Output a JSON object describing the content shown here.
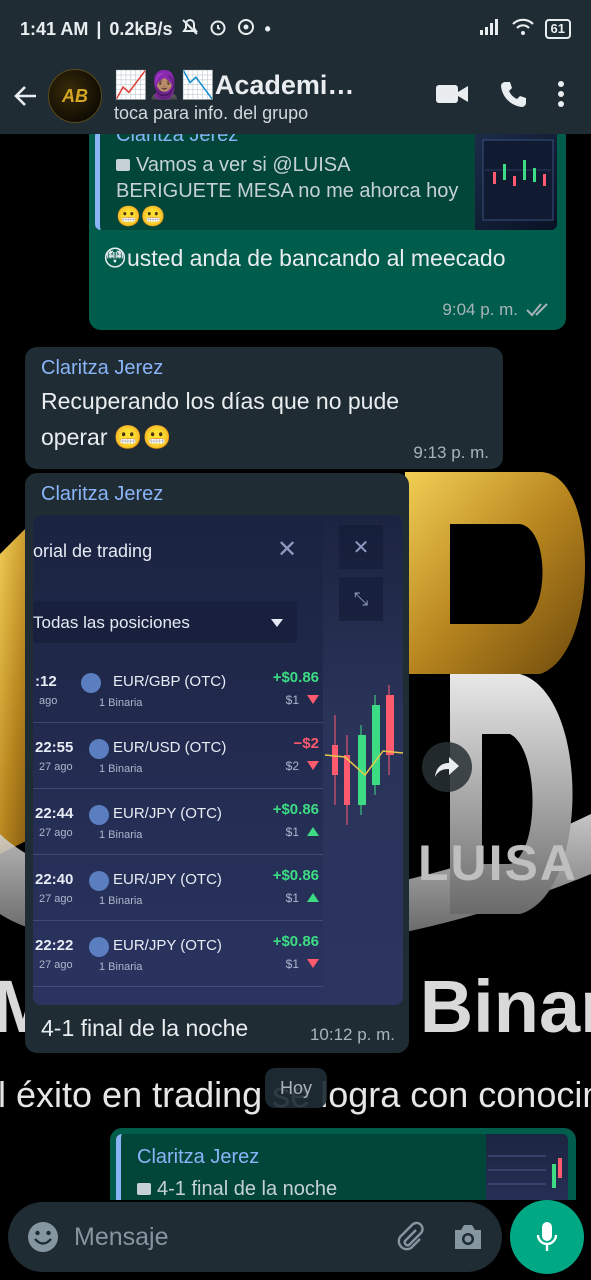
{
  "status": {
    "time": "1:41 AM",
    "speed": "0.2kB/s",
    "battery": "61"
  },
  "header": {
    "avatar_text": "AB",
    "title": "📈🧕🏽📉Academia...",
    "subtitle": "toca para info. del grupo"
  },
  "messages": {
    "m1": {
      "quote_sender": "Claritza Jerez",
      "quote_text": "Vamos a ver si @LUISA BERIGUETE MESA no me ahorca hoy 😬😬",
      "text": "😳usted anda de bancando al meecado",
      "time": "9:04 p. m."
    },
    "m2": {
      "sender": "Claritza Jerez",
      "text": "Recuperando los días que no pude operar 😬😬",
      "time": "9:13 p. m."
    },
    "m3": {
      "sender": "Claritza Jerez",
      "caption": "4-1 final de la noche",
      "time": "10:12 p. m.",
      "image": {
        "panel_title": "orial de trading",
        "filter": "Todas las posiciones",
        "trades": [
          {
            "time": ":12",
            "date": "ago",
            "pair": "EUR/GBP (OTC)",
            "type": "1 Binaria",
            "pl": "+$0.86",
            "amount": "$1",
            "dir": "down"
          },
          {
            "time": "22:55",
            "date": "27 ago",
            "pair": "EUR/USD (OTC)",
            "type": "1 Binaria",
            "pl": "−$2",
            "amount": "$2",
            "dir": "down"
          },
          {
            "time": "22:44",
            "date": "27 ago",
            "pair": "EUR/JPY (OTC)",
            "type": "1 Binaria",
            "pl": "+$0.86",
            "amount": "$1",
            "dir": "up"
          },
          {
            "time": "22:40",
            "date": "27 ago",
            "pair": "EUR/JPY (OTC)",
            "type": "1 Binaria",
            "pl": "+$0.86",
            "amount": "$1",
            "dir": "up"
          },
          {
            "time": "22:22",
            "date": "27 ago",
            "pair": "EUR/JPY (OTC)",
            "type": "1 Binaria",
            "pl": "+$0.86",
            "amount": "$1",
            "dir": "down"
          }
        ]
      }
    },
    "m4": {
      "quote_sender": "Claritza Jerez",
      "quote_text": "4-1 final de la noche"
    }
  },
  "wallpaper": {
    "brand_word": "LUISA",
    "line1": "Maestría en Binar",
    "line2": "l éxito en trading se logra con conocimie"
  },
  "day_chip": "Hoy",
  "input": {
    "placeholder": "Mensaje"
  },
  "colors": {
    "header_bg": "#1f2c34",
    "outgoing_bubble": "#005c4b",
    "incoming_bubble": "#1f2c34",
    "accent": "#00a884",
    "sender_name": "#8ab4f8",
    "profit": "#3ddc84",
    "loss": "#ff5a6e"
  }
}
